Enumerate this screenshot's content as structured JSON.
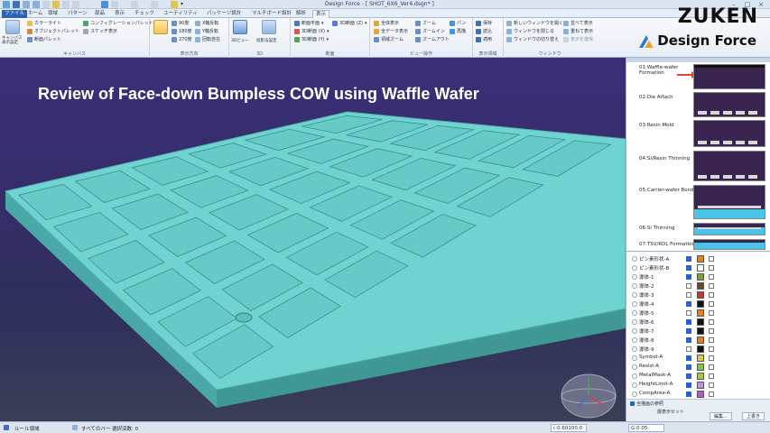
{
  "window": {
    "title": "Design Force - [ SHOT_6X6_Ver4.dsgn* ]"
  },
  "tabs": [
    {
      "label": "ファイル"
    },
    {
      "label": "ホーム"
    },
    {
      "label": "領域"
    },
    {
      "label": "パターン"
    },
    {
      "label": "部品"
    },
    {
      "label": "表示"
    },
    {
      "label": "チェック"
    },
    {
      "label": "ユーティリティ"
    },
    {
      "label": "パッケージ設計"
    },
    {
      "label": "マルチボード設計"
    },
    {
      "label": "解析"
    },
    {
      "label": "表示"
    }
  ],
  "ribbon": {
    "groups": [
      {
        "label": "キャンバス"
      },
      {
        "label": "表示方向"
      },
      {
        "label": "3D"
      },
      {
        "label": "断面"
      },
      {
        "label": "ビュー操作"
      },
      {
        "label": "表示領域"
      },
      {
        "label": "ウィンドウ"
      }
    ],
    "items": {
      "canvas": "キャンバス 表示設定",
      "color_light": "カラーライト",
      "object_palette": "オブジェクトパレット",
      "config_palette": "コンフィグレーションパレット",
      "sketch": "スケッチ表示",
      "section_palette": "断面パレット",
      "deg90": "90度",
      "deg180": "180度",
      "deg270": "270度",
      "x_mirror": "X軸反転",
      "y_mirror": "Y軸反転",
      "free_rot": "回転自在",
      "view3d": "3Dビュー",
      "proj_set": "投影法設定",
      "sec_plane": "断面平面",
      "sec_x": "3D断面 (X)",
      "sec_y": "3D断面 (Y)",
      "sec_z": "3D断面 (Z)",
      "fit_all": "全体表示",
      "all_data": "全データ表示",
      "area_zoom": "領域ズーム",
      "zoom": "ズーム",
      "zoom_in": "ズームイン",
      "zoom_out": "ズームアウト",
      "pan": "パン",
      "redraw": "再描",
      "save": "保存",
      "load": "読込",
      "apply": "適用",
      "win_new": "新しいウィンドウを開く",
      "win_close": "ウィンドウを閉じる",
      "win_switch": "ウィンドウの切り替え",
      "tile": "並べて表示",
      "cascade": "重ねて表示",
      "restore": "表示を復帰"
    }
  },
  "logo": {
    "brand": "ZUKEN",
    "product": "Design Force"
  },
  "viewport": {
    "headline": "Review of Face-down Bumpless COW using Waffle Wafer",
    "wafer_color": "#6fd3cf",
    "background_color": "#372f6e"
  },
  "process_steps": [
    {
      "label": "01:Waffle-wafer Formation"
    },
    {
      "label": "02:Die Attach"
    },
    {
      "label": "03:Resin Mold"
    },
    {
      "label": "04:Si/Resin Thinning"
    },
    {
      "label": "05:Carrier-wafer Bond"
    },
    {
      "label": "06:Si Thinning"
    },
    {
      "label": "07:TSV/RDL Formation"
    }
  ],
  "layers": [
    {
      "name": "ピン素形状-A",
      "visible": true,
      "color": "#e5821f"
    },
    {
      "name": "ピン素形状-B",
      "visible": true,
      "color": "#ffffff"
    },
    {
      "name": "導体-1",
      "visible": true,
      "color": "#7aa334"
    },
    {
      "name": "導体-2",
      "visible": false,
      "color": "#6b4a2d"
    },
    {
      "name": "導体-3",
      "visible": false,
      "color": "#c0392b"
    },
    {
      "name": "導体-4",
      "visible": true,
      "color": "#111111"
    },
    {
      "name": "導体-5",
      "visible": false,
      "color": "#e5821f"
    },
    {
      "name": "導体-6",
      "visible": true,
      "color": "#111111"
    },
    {
      "name": "導体-7",
      "visible": true,
      "color": "#111111"
    },
    {
      "name": "導体-8",
      "visible": true,
      "color": "#e5821f"
    },
    {
      "name": "導体-9",
      "visible": false,
      "color": "#111111"
    },
    {
      "name": "Symbol-A",
      "visible": true,
      "color": "#d8c84a"
    },
    {
      "name": "Resist-A",
      "visible": true,
      "color": "#7ac943"
    },
    {
      "name": "MetalMask-A",
      "visible": true,
      "color": "#a7c63e"
    },
    {
      "name": "HeightLimit-A",
      "visible": true,
      "color": "#c78be0"
    },
    {
      "name": "CompArea-A",
      "visible": true,
      "color": "#b15bd1"
    }
  ],
  "panel_footer": {
    "all_layers": "全描画の参照",
    "display_set": "層表示セット",
    "edit_btn": "編集...",
    "up_btn": "上書き"
  },
  "statusbar": {
    "mode": "ルール領域",
    "all_bars": "すべてのバー",
    "selected": "選択済数: 0",
    "coord": "(-0.60100,0",
    "grid": "G:0.05"
  }
}
